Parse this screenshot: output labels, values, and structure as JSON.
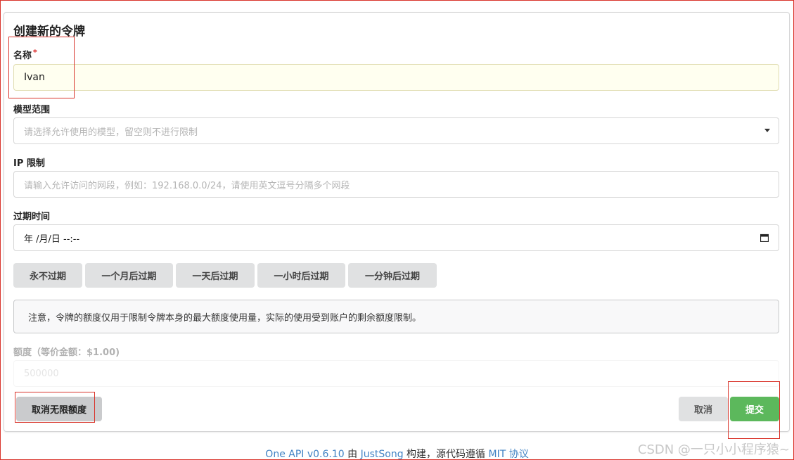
{
  "form": {
    "title": "创建新的令牌",
    "name_label": "名称",
    "name_required_mark": "*",
    "name_value": "Ivan",
    "models_label": "模型范围",
    "models_placeholder": "请选择允许使用的模型，留空则不进行限制",
    "ip_label": "IP 限制",
    "ip_placeholder": "请输入允许访问的网段，例如：192.168.0.0/24，请使用英文逗号分隔多个网段",
    "expire_label": "过期时间",
    "expire_value": "年 /月/日 --:--",
    "expire_buttons": [
      "永不过期",
      "一个月后过期",
      "一天后过期",
      "一小时后过期",
      "一分钟后过期"
    ],
    "notice": "注意，令牌的额度仅用于限制令牌本身的最大额度使用量，实际的使用受到账户的剩余额度限制。",
    "quota_label": "额度（等价金额：$1.00)",
    "quota_placeholder": "500000",
    "unlimited_button": "取消无限额度",
    "cancel_button": "取消",
    "submit_button": "提交"
  },
  "footer": {
    "app": "One API v0.6.10",
    "by": " 由 ",
    "author": "JustSong",
    "built": " 构建，源代码遵循 ",
    "license": "MIT 协议"
  },
  "watermark": "CSDN @一只小小程序猿~",
  "colors": {
    "submit": "#5cb85c",
    "accent_red": "#d9342b",
    "link": "#4183c4"
  }
}
